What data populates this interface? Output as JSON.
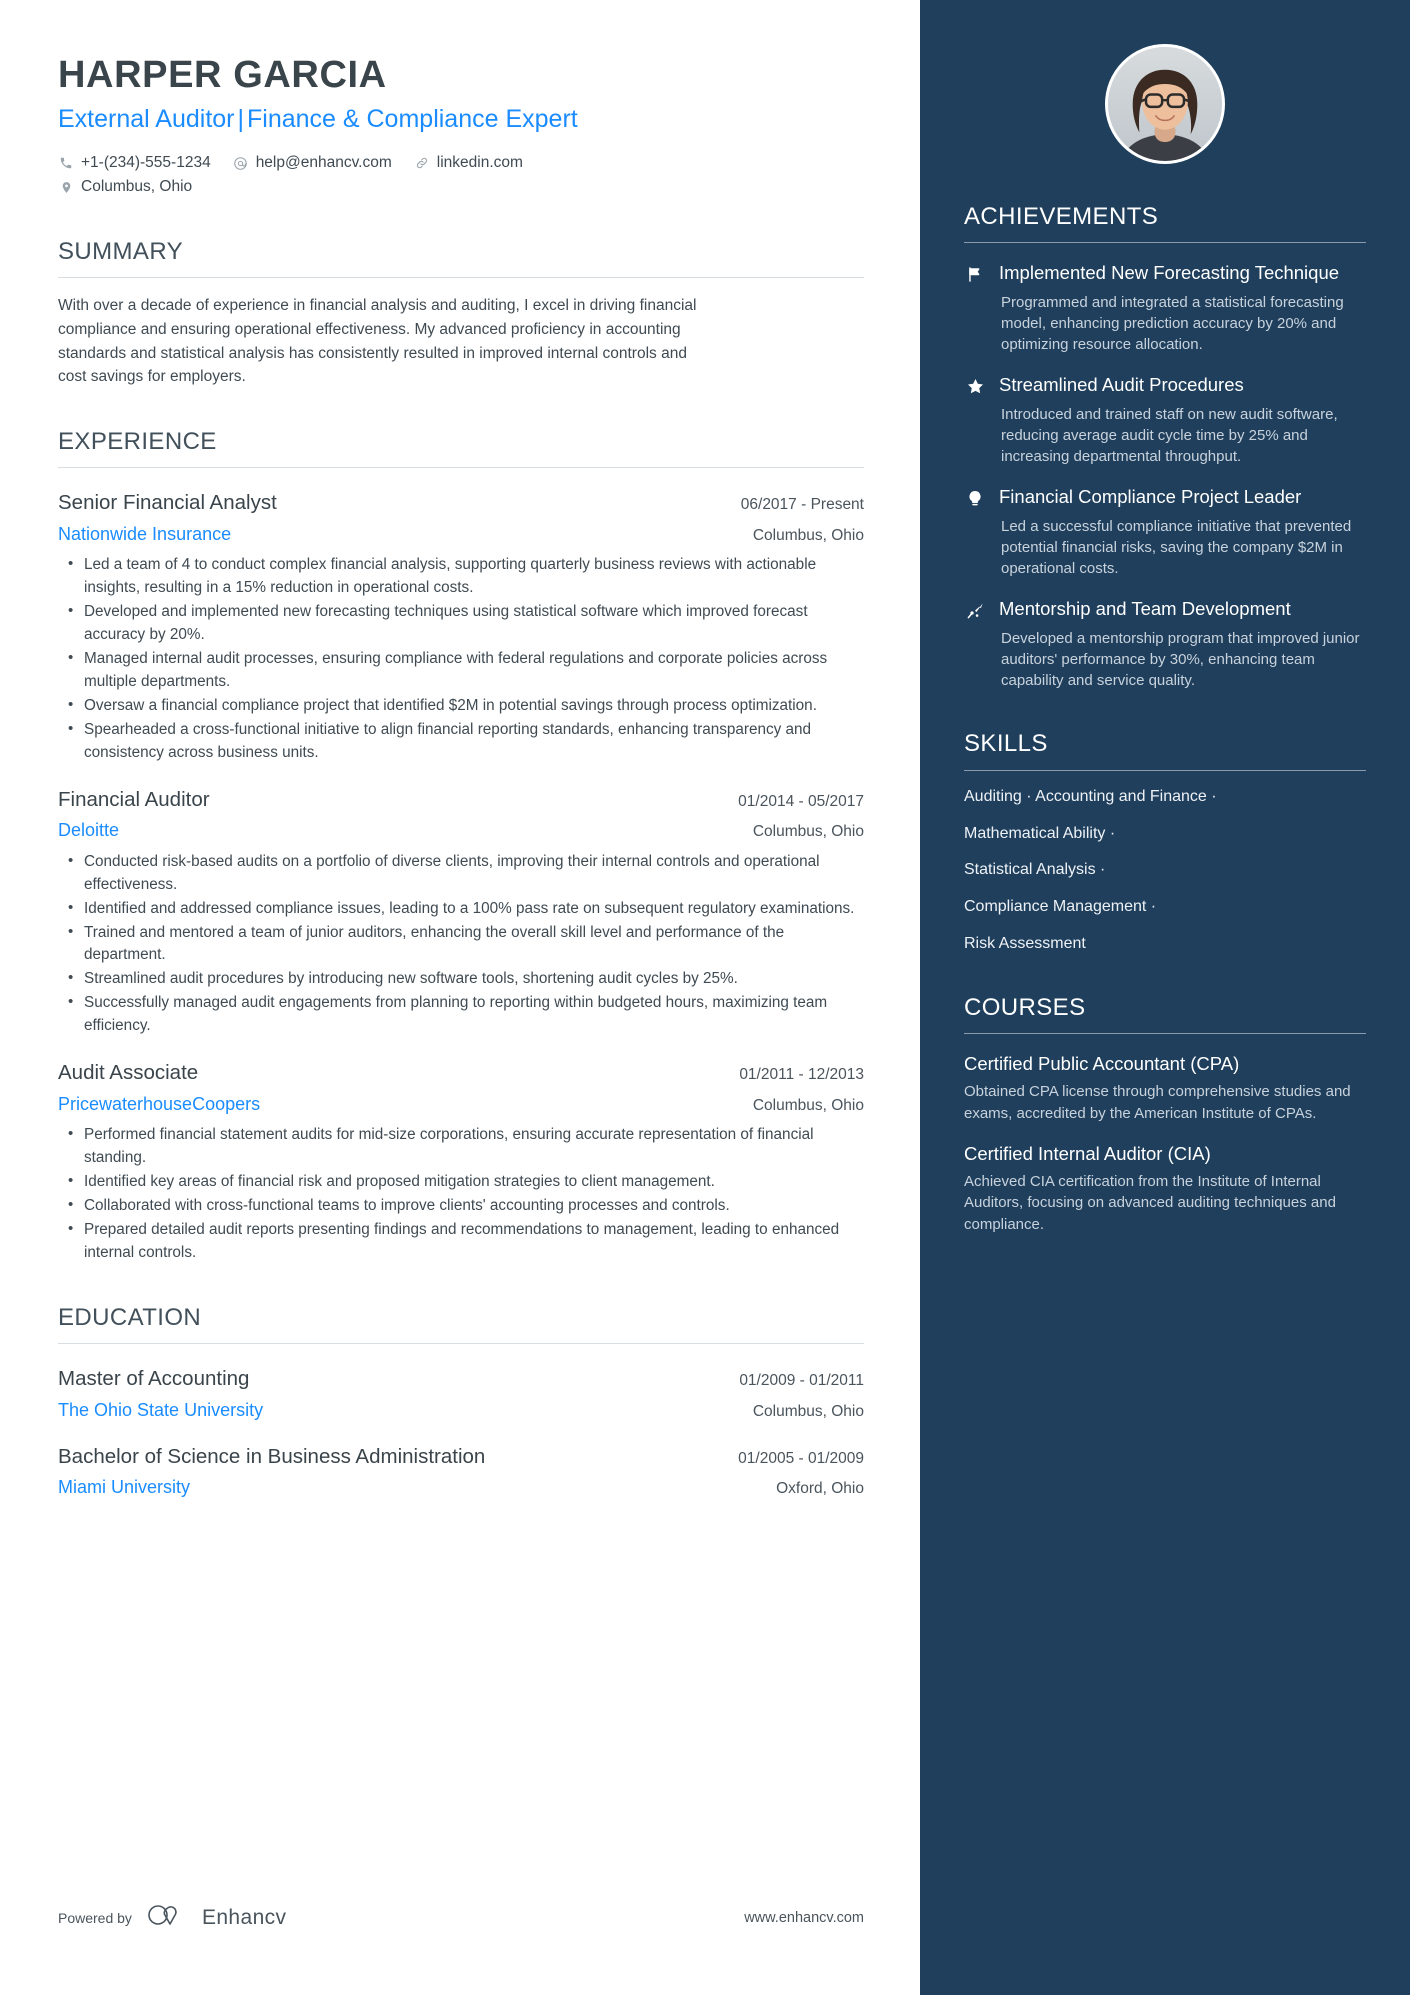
{
  "colors": {
    "accent_blue": "#1a8cff",
    "sidebar_bg": "#1f3f5c",
    "heading_gray": "#41505a",
    "body_gray": "#3f4a52",
    "sidebar_muted": "#c8d2dc"
  },
  "header": {
    "name": "HARPER GARCIA",
    "headline_left": "External Auditor",
    "headline_separator": "|",
    "headline_right": "Finance & Compliance Expert",
    "contacts": [
      {
        "icon": "phone-icon",
        "text": "+1-(234)-555-1234"
      },
      {
        "icon": "email-icon",
        "text": "help@enhancv.com"
      },
      {
        "icon": "link-icon",
        "text": "linkedin.com"
      },
      {
        "icon": "location-icon",
        "text": "Columbus, Ohio"
      }
    ]
  },
  "summary": {
    "title": "SUMMARY",
    "text": "With over a decade of experience in financial analysis and auditing, I excel in driving financial compliance and ensuring operational effectiveness. My advanced proficiency in accounting standards and statistical analysis has consistently resulted in improved internal controls and cost savings for employers."
  },
  "experience": {
    "title": "EXPERIENCE",
    "entries": [
      {
        "role": "Senior Financial Analyst",
        "date": "06/2017 - Present",
        "org": "Nationwide Insurance",
        "location": "Columbus, Ohio",
        "bullets": [
          "Led a team of 4 to conduct complex financial analysis, supporting quarterly business reviews with actionable insights, resulting in a 15% reduction in operational costs.",
          "Developed and implemented new forecasting techniques using statistical software which improved forecast accuracy by 20%.",
          "Managed internal audit processes, ensuring compliance with federal regulations and corporate policies across multiple departments.",
          "Oversaw a financial compliance project that identified $2M in potential savings through process optimization.",
          "Spearheaded a cross-functional initiative to align financial reporting standards, enhancing transparency and consistency across business units."
        ]
      },
      {
        "role": "Financial Auditor",
        "date": "01/2014 - 05/2017",
        "org": "Deloitte",
        "location": "Columbus, Ohio",
        "bullets": [
          "Conducted risk-based audits on a portfolio of diverse clients, improving their internal controls and operational effectiveness.",
          "Identified and addressed compliance issues, leading to a 100% pass rate on subsequent regulatory examinations.",
          "Trained and mentored a team of junior auditors, enhancing the overall skill level and performance of the department.",
          "Streamlined audit procedures by introducing new software tools, shortening audit cycles by 25%.",
          "Successfully managed audit engagements from planning to reporting within budgeted hours, maximizing team efficiency."
        ]
      },
      {
        "role": "Audit Associate",
        "date": "01/2011 - 12/2013",
        "org": "PricewaterhouseCoopers",
        "location": "Columbus, Ohio",
        "bullets": [
          "Performed financial statement audits for mid-size corporations, ensuring accurate representation of financial standing.",
          "Identified key areas of financial risk and proposed mitigation strategies to client management.",
          "Collaborated with cross-functional teams to improve clients' accounting processes and controls.",
          "Prepared detailed audit reports presenting findings and recommendations to management, leading to enhanced internal controls."
        ]
      }
    ]
  },
  "education": {
    "title": "EDUCATION",
    "entries": [
      {
        "degree": "Master of Accounting",
        "date": "01/2009 - 01/2011",
        "school": "The Ohio State University",
        "location": "Columbus, Ohio"
      },
      {
        "degree": "Bachelor of Science in Business Administration",
        "date": "01/2005 - 01/2009",
        "school": "Miami University",
        "location": "Oxford, Ohio"
      }
    ]
  },
  "footer": {
    "powered_by": "Powered by",
    "brand": "Enhancv",
    "url": "www.enhancv.com"
  },
  "sidebar": {
    "achievements": {
      "title": "ACHIEVEMENTS",
      "items": [
        {
          "icon": "flag-icon",
          "title": "Implemented New Forecasting Technique",
          "desc": "Programmed and integrated a statistical forecasting model, enhancing prediction accuracy by 20% and optimizing resource allocation."
        },
        {
          "icon": "star-icon",
          "title": "Streamlined Audit Procedures",
          "desc": "Introduced and trained staff on new audit software, reducing average audit cycle time by 25% and increasing departmental throughput."
        },
        {
          "icon": "lightbulb-icon",
          "title": "Financial Compliance Project Leader",
          "desc": "Led a successful compliance initiative that prevented potential financial risks, saving the company $2M in operational costs."
        },
        {
          "icon": "growth-arrow-icon",
          "title": "Mentorship and Team Development",
          "desc": "Developed a mentorship program that improved junior auditors' performance by 30%, enhancing team capability and service quality."
        }
      ]
    },
    "skills": {
      "title": "SKILLS",
      "lines": [
        "Auditing · Accounting and Finance ·",
        "Mathematical Ability ·",
        "Statistical Analysis ·",
        "Compliance Management ·",
        "Risk Assessment"
      ]
    },
    "courses": {
      "title": "COURSES",
      "items": [
        {
          "title": "Certified Public Accountant (CPA)",
          "desc": "Obtained CPA license through comprehensive studies and exams, accredited by the American Institute of CPAs."
        },
        {
          "title": "Certified Internal Auditor (CIA)",
          "desc": "Achieved CIA certification from the Institute of Internal Auditors, focusing on advanced auditing techniques and compliance."
        }
      ]
    }
  }
}
